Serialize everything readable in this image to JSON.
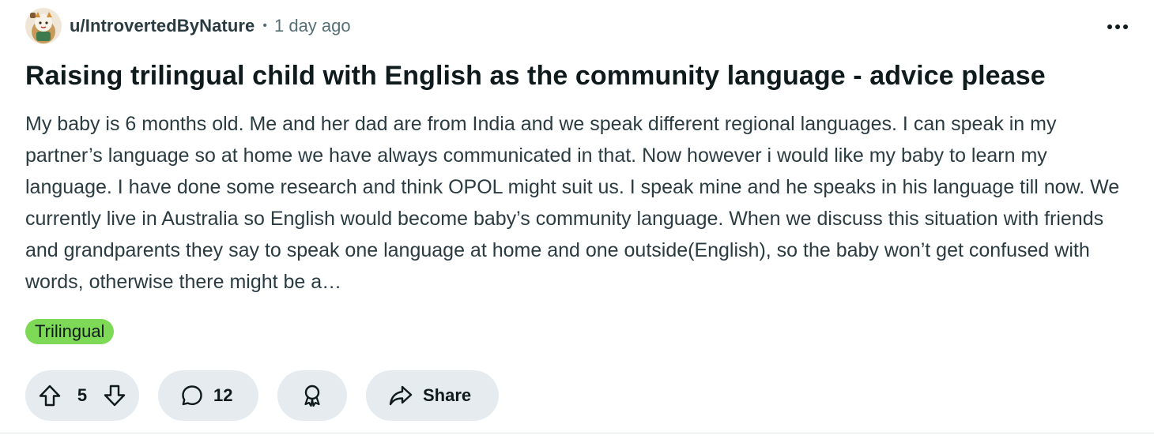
{
  "post": {
    "username": "u/IntrovertedByNature",
    "separator": "•",
    "timestamp": "1 day ago",
    "title": "Raising trilingual child with English as the community language - advice please",
    "body": "My baby is 6 months old. Me and her dad are from India and we speak different regional languages. I can speak in my partner’s language so at home we have always communicated in that. Now however i would like my baby to learn my language. I have done some research and think OPOL might suit us. I speak mine and he speaks in his language till now. We currently live in Australia so English would become baby’s community language. When we discuss this situation with friends and grandparents they say to speak one language at home and one outside(English), so the baby won’t get confused with words, otherwise there might be a…",
    "flair": "Trilingual",
    "flair_color": "#7ed957"
  },
  "actions": {
    "vote_count": "5",
    "comment_count": "12",
    "share_label": "Share"
  },
  "icons": {
    "more": "more-horizontal-icon",
    "upvote": "upvote-arrow-icon",
    "downvote": "downvote-arrow-icon",
    "comment": "comment-bubble-icon",
    "award": "award-ribbon-icon",
    "share": "share-arrow-icon"
  },
  "colors": {
    "pill_background": "#e5ebee",
    "meta_text": "#576f76",
    "body_text": "#2a3c42"
  }
}
